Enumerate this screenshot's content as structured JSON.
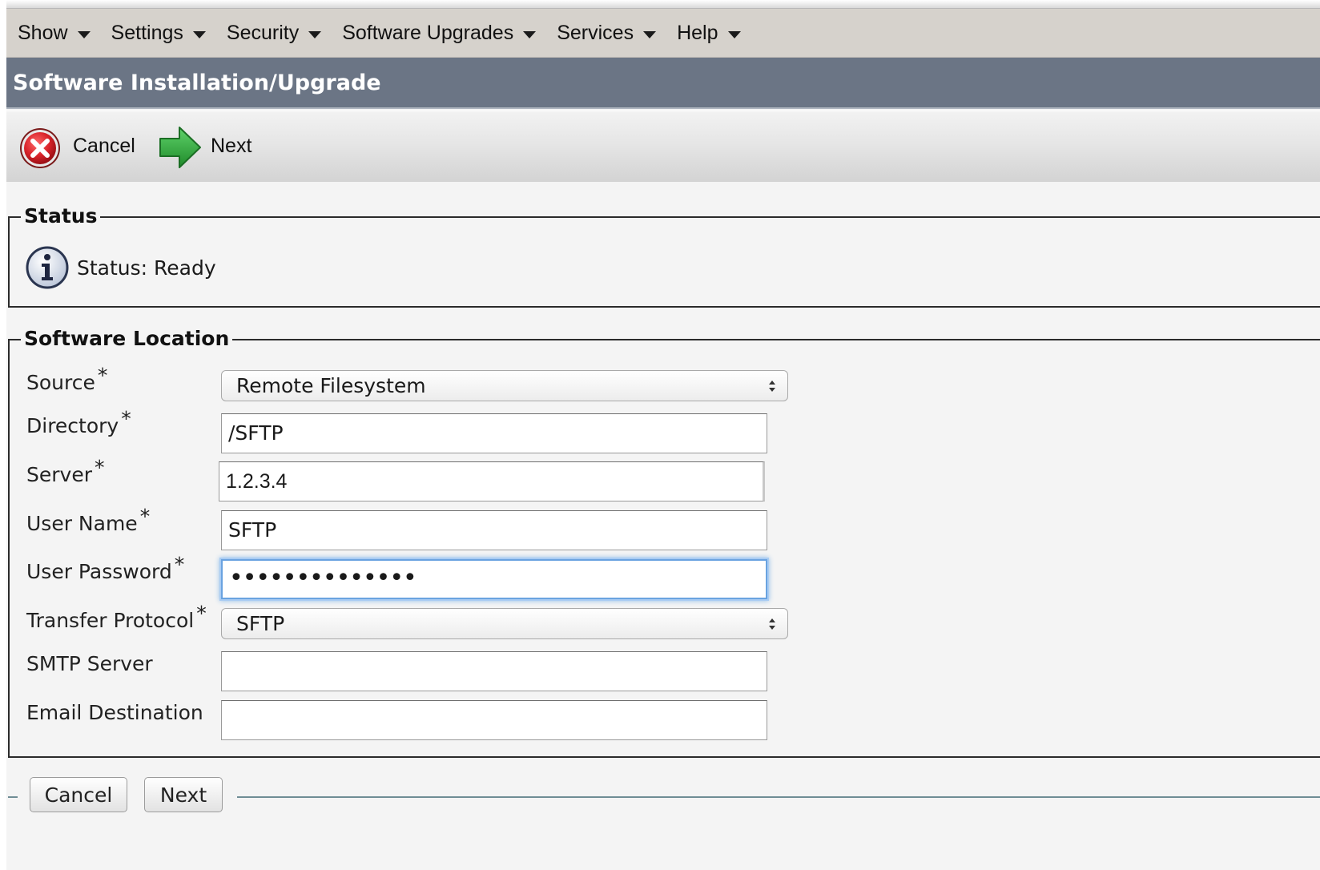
{
  "menubar": {
    "items": [
      "Show",
      "Settings",
      "Security",
      "Software Upgrades",
      "Services",
      "Help"
    ]
  },
  "page": {
    "title": "Software Installation/Upgrade"
  },
  "toolbar": {
    "cancel_label": "Cancel",
    "next_label": "Next"
  },
  "status": {
    "legend": "Status",
    "text": "Status: Ready"
  },
  "location": {
    "legend": "Software Location",
    "required_marker": "*",
    "fields": {
      "source": {
        "label": "Source",
        "value": "Remote Filesystem"
      },
      "directory": {
        "label": "Directory",
        "value": "/SFTP"
      },
      "server": {
        "label": "Server",
        "value": "1.2.3.4"
      },
      "user_name": {
        "label": "User Name",
        "value": "SFTP"
      },
      "user_password": {
        "label": "User Password",
        "value": "••••••••••••••"
      },
      "transfer_protocol": {
        "label": "Transfer Protocol",
        "value": "SFTP"
      },
      "smtp_server": {
        "label": "SMTP Server",
        "value": ""
      },
      "email_destination": {
        "label": "Email Destination",
        "value": ""
      }
    }
  },
  "footer": {
    "cancel_label": "Cancel",
    "next_label": "Next"
  },
  "icons": {
    "cancel": "cancel-x-icon",
    "next": "next-arrow-icon",
    "info": "info-icon",
    "caret": "chevron-down-icon"
  },
  "colors": {
    "menubar_bg": "#d6d2cc",
    "titlebar_bg": "#6b7585",
    "focus_ring": "#6aa3e0",
    "cancel_red": "#d9232a",
    "next_green": "#2fa53a"
  }
}
